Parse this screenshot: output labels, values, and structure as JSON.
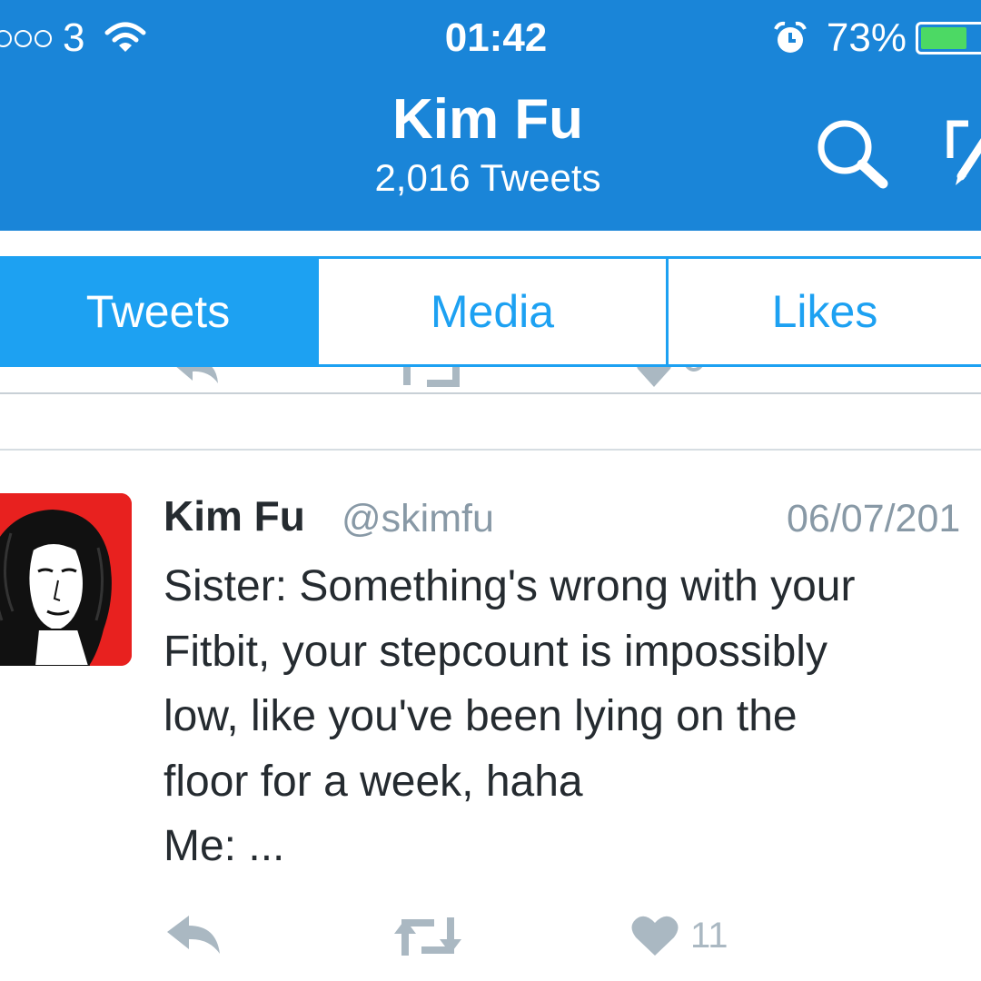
{
  "status_bar": {
    "carrier": "3",
    "time": "01:42",
    "battery_percent": "73%",
    "battery_level": 0.73,
    "icons": [
      "signal-dots",
      "wifi-icon",
      "alarm-icon",
      "battery-icon"
    ]
  },
  "header": {
    "name": "Kim Fu",
    "tweet_count": "2,016 Tweets",
    "icons": [
      "search-icon",
      "compose-icon"
    ]
  },
  "tabs": [
    {
      "label": "Tweets",
      "active": true
    },
    {
      "label": "Media",
      "active": false
    },
    {
      "label": "Likes",
      "active": false
    }
  ],
  "tweet": {
    "author": "Kim Fu",
    "handle": "@skimfu",
    "date": "06/07/201",
    "text": "Sister: Something's wrong with your\nFitbit, your stepcount is impossibly\nlow, like you've been lying on the\nfloor for a week, haha\nMe: ...",
    "like_count": "11",
    "actions": [
      "reply-icon",
      "retweet-icon",
      "heart-icon"
    ]
  },
  "colors": {
    "header_blue": "#1a85d8",
    "tab_blue": "#1da1f2",
    "text_dark": "#252b30",
    "text_gray": "#8899a6",
    "icon_gray": "#aab8c2",
    "battery_green": "#4cd964",
    "avatar_red": "#e8211f"
  }
}
